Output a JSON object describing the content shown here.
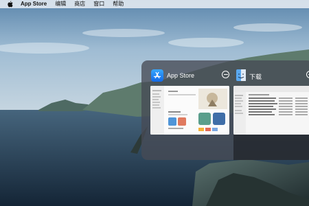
{
  "menubar": {
    "app_name": "App Store",
    "items": [
      "编辑",
      "商店",
      "窗口",
      "帮助"
    ]
  },
  "switcher": {
    "apps": [
      {
        "title": "App Store",
        "icon": "app-store-icon"
      },
      {
        "title": "下载",
        "icon": "finder-icon"
      }
    ]
  },
  "colors": {
    "app_store_blue": "#1a7ef0",
    "switcher_bg": "#464a54"
  }
}
